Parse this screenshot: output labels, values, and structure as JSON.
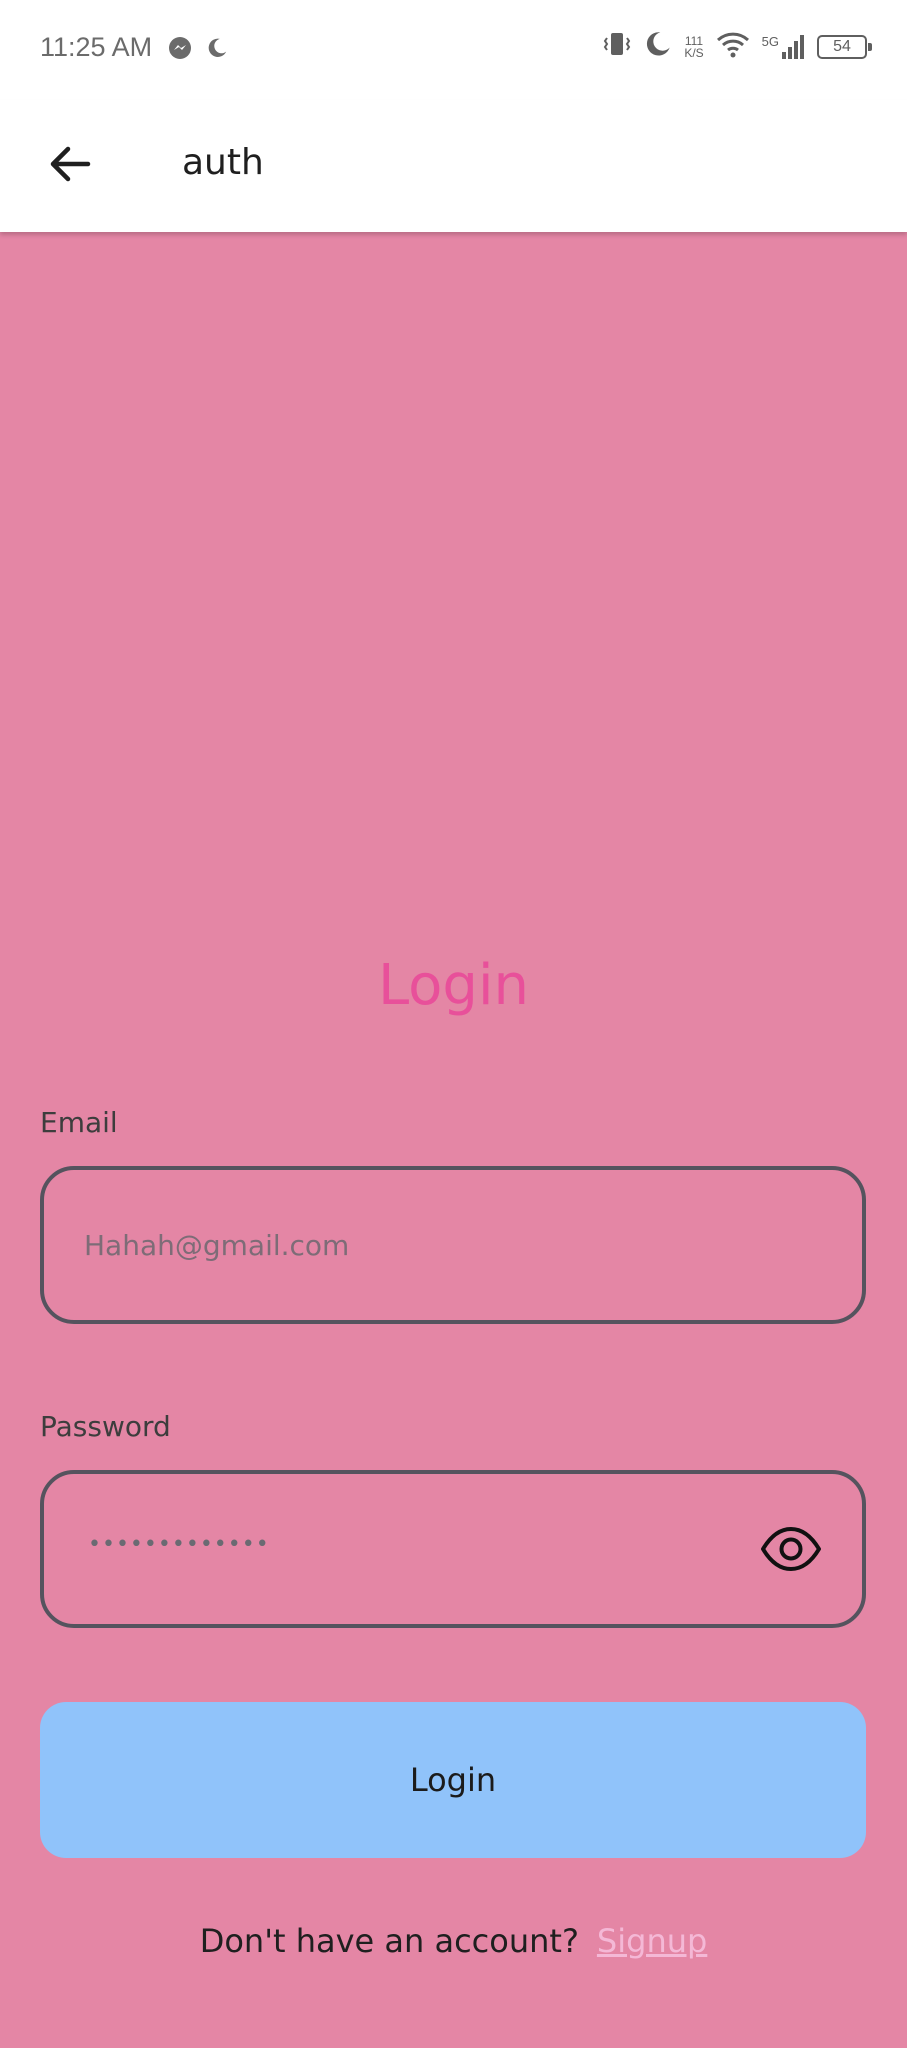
{
  "status_bar": {
    "time": "11:25 AM",
    "net_speed_value": "111",
    "net_speed_unit": "K/S",
    "signal_label": "5G",
    "battery": "54"
  },
  "app_bar": {
    "title": "auth"
  },
  "login": {
    "heading": "Login",
    "email_label": "Email",
    "email_placeholder": "Hahah@gmail.com",
    "password_label": "Password",
    "password_masked": "•••••••••••••",
    "button_label": "Login",
    "signup_prompt": "Don't have an account?",
    "signup_link": "Signup"
  },
  "colors": {
    "background": "#e486a5",
    "heading": "#e8509a",
    "button": "#90c3fa",
    "link": "#f4b8d6",
    "field_border": "#55535e"
  }
}
